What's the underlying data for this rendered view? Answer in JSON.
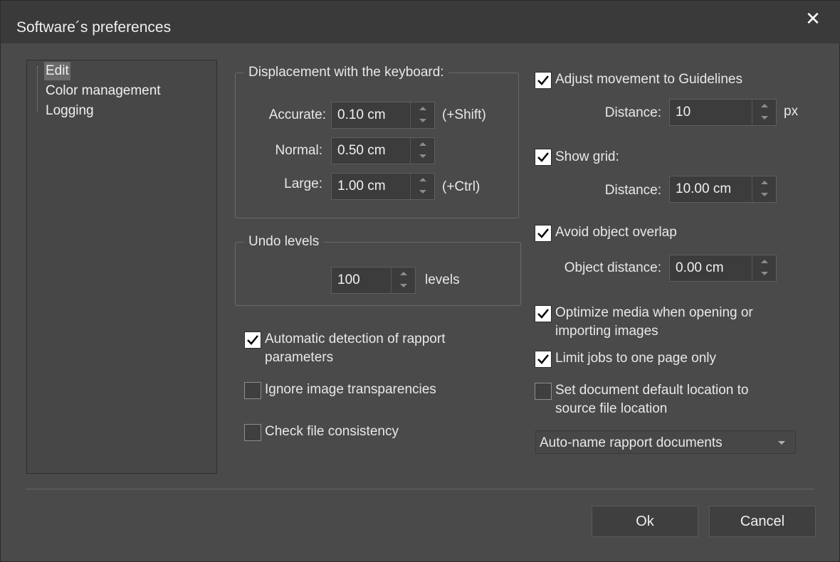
{
  "window": {
    "title": "Software´s preferences",
    "close_icon": "close-icon"
  },
  "tree": {
    "items": [
      {
        "label": "Edit",
        "selected": true
      },
      {
        "label": "Color management",
        "selected": false
      },
      {
        "label": "Logging",
        "selected": false
      }
    ]
  },
  "displacement": {
    "legend": "Displacement with the keyboard:",
    "accurate": {
      "label": "Accurate:",
      "value": "0.10 cm",
      "suffix": "(+Shift)"
    },
    "normal": {
      "label": "Normal:",
      "value": "0.50 cm"
    },
    "large": {
      "label": "Large:",
      "value": "1.00 cm",
      "suffix": "(+Ctrl)"
    }
  },
  "undo": {
    "legend": "Undo levels",
    "value": "100",
    "suffix": "levels"
  },
  "left_checks": {
    "auto_detect": {
      "label_line1": "Automatic detection of rapport",
      "label_line2": "parameters",
      "checked": true
    },
    "ignore_transp": {
      "label": "Ignore image transparencies",
      "checked": false
    },
    "check_file": {
      "label": "Check file consistency",
      "checked": false
    }
  },
  "guidelines": {
    "label": "Adjust movement to Guidelines",
    "checked": true,
    "distance_label": "Distance:",
    "distance_value": "10",
    "unit": "px"
  },
  "grid": {
    "label": "Show grid:",
    "checked": true,
    "distance_label": "Distance:",
    "distance_value": "10.00 cm"
  },
  "overlap": {
    "label": "Avoid object overlap",
    "checked": true,
    "distance_label": "Object distance:",
    "distance_value": "0.00 cm"
  },
  "optimize": {
    "label_line1": "Optimize media when opening or",
    "label_line2": "importing images",
    "checked": true
  },
  "limit_jobs": {
    "label": "Limit jobs to one page only",
    "checked": true
  },
  "doc_location": {
    "label_line1": "Set document default location to",
    "label_line2": "source file location",
    "checked": false
  },
  "auto_name": {
    "selected": "Auto-name rapport documents"
  },
  "buttons": {
    "ok": "Ok",
    "cancel": "Cancel"
  },
  "colors": {
    "dialog_bg": "#4a4a4a",
    "titlebar_bg": "#3a3a3a",
    "text": "#e8e8e8",
    "check_bg": "#ffffff"
  }
}
